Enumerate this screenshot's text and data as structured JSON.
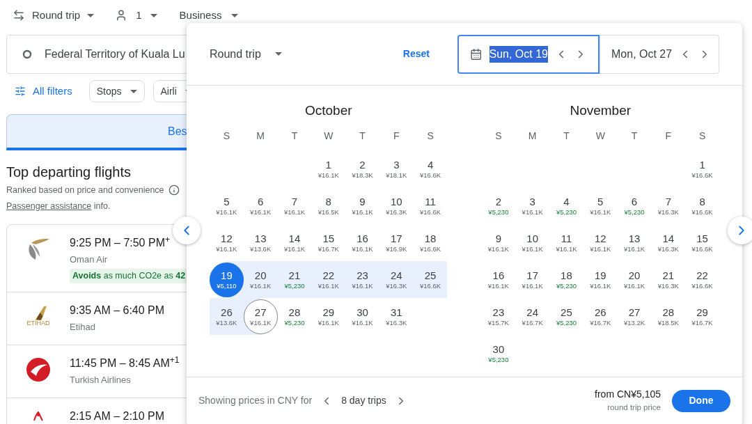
{
  "top_bar": {
    "trip_type": "Round trip",
    "passengers": "1",
    "cabin": "Business"
  },
  "search": {
    "origin": "Federal Territory of Kuala Lu"
  },
  "filters": {
    "all_filters": "All filters",
    "chips": [
      "Stops",
      "Airli"
    ]
  },
  "sort_tab": {
    "label": "Bes",
    "selected": true
  },
  "section": {
    "title": "Top departing flights",
    "subtitle": "Ranked based on price and convenience",
    "assistance_link": "Passenger assistance",
    "assistance_rest": " info."
  },
  "flights": [
    {
      "kind": "wing",
      "times": "9:25 PM – 7:50 PM$^{+}$",
      "airline": "Oman Air",
      "badge": "**Avoids** as much CO2e as **42**"
    },
    {
      "kind": "tail",
      "times": "9:35 AM – 6:40 PM",
      "airline": "Etihad",
      "logo_text": "ETIHAD"
    },
    {
      "kind": "crescent",
      "times": "11:45 PM – 8:45 AM$^{+1}$",
      "airline": "Turkish Airlines"
    },
    {
      "kind": "script",
      "times": "2:15 AM – 2:10 PM"
    }
  ],
  "date_picker": {
    "trip_type": "Round trip",
    "reset": "Reset",
    "depart": {
      "value": "Sun, Oct 19",
      "focused": true
    },
    "return": {
      "value": "Mon, Oct 27",
      "focused": false
    },
    "months": [
      {
        "name": "October",
        "weekdays": [
          "S",
          "M",
          "T",
          "W",
          "T",
          "F",
          "S"
        ],
        "weeks": [
          [
            {
              "kind": "blank"
            },
            {
              "kind": "blank"
            },
            {
              "kind": "blank"
            },
            {
              "day": "1",
              "price": "¥16.1K",
              "low": false,
              "kind": "plain"
            },
            {
              "day": "2",
              "price": "¥18.3K",
              "low": false,
              "kind": "plain"
            },
            {
              "day": "3",
              "price": "¥18.1K",
              "low": false,
              "kind": "plain"
            },
            {
              "day": "4",
              "price": "¥16.6K",
              "low": false,
              "kind": "plain"
            }
          ],
          [
            {
              "day": "5",
              "price": "¥16.1K",
              "low": false,
              "kind": "plain"
            },
            {
              "day": "6",
              "price": "¥16.1K",
              "low": false,
              "kind": "plain"
            },
            {
              "day": "7",
              "price": "¥16.1K",
              "low": false,
              "kind": "plain"
            },
            {
              "day": "8",
              "price": "¥16.5K",
              "low": false,
              "kind": "plain"
            },
            {
              "day": "9",
              "price": "¥16.1K",
              "low": false,
              "kind": "plain"
            },
            {
              "day": "10",
              "price": "¥16.3K",
              "low": false,
              "kind": "plain"
            },
            {
              "day": "11",
              "price": "¥16.6K",
              "low": false,
              "kind": "plain"
            }
          ],
          [
            {
              "day": "12",
              "price": "¥16.1K",
              "low": false,
              "kind": "plain"
            },
            {
              "day": "13",
              "price": "¥13.6K",
              "low": false,
              "kind": "plain"
            },
            {
              "day": "14",
              "price": "¥16.1K",
              "low": false,
              "kind": "plain"
            },
            {
              "day": "15",
              "price": "¥16.7K",
              "low": false,
              "kind": "plain"
            },
            {
              "day": "16",
              "price": "¥16.1K",
              "low": false,
              "kind": "plain"
            },
            {
              "day": "17",
              "price": "¥16.9K",
              "low": false,
              "kind": "plain"
            },
            {
              "day": "18",
              "price": "¥16.6K",
              "low": false,
              "kind": "plain"
            }
          ],
          [
            {
              "day": "19",
              "price": "¥5,110",
              "low": false,
              "kind": "start"
            },
            {
              "day": "20",
              "price": "¥16.1K",
              "low": false,
              "kind": "range"
            },
            {
              "day": "21",
              "price": "¥5,230",
              "low": true,
              "kind": "range"
            },
            {
              "day": "22",
              "price": "¥16.1K",
              "low": false,
              "kind": "range"
            },
            {
              "day": "23",
              "price": "¥16.1K",
              "low": false,
              "kind": "range"
            },
            {
              "day": "24",
              "price": "¥16.3K",
              "low": false,
              "kind": "range"
            },
            {
              "day": "25",
              "price": "¥16.6K",
              "low": false,
              "kind": "range"
            }
          ],
          [
            {
              "day": "26",
              "price": "¥13.6K",
              "low": false,
              "kind": "range"
            },
            {
              "day": "27",
              "price": "¥16.1K",
              "low": false,
              "kind": "end"
            },
            {
              "day": "28",
              "price": "¥5,230",
              "low": true,
              "kind": "plain"
            },
            {
              "day": "29",
              "price": "¥16.1K",
              "low": false,
              "kind": "plain"
            },
            {
              "day": "30",
              "price": "¥16.1K",
              "low": false,
              "kind": "plain"
            },
            {
              "day": "31",
              "price": "¥16.3K",
              "low": false,
              "kind": "plain"
            },
            {
              "kind": "blank"
            }
          ]
        ]
      },
      {
        "name": "November",
        "weekdays": [
          "S",
          "M",
          "T",
          "W",
          "T",
          "F",
          "S"
        ],
        "weeks": [
          [
            {
              "kind": "blank"
            },
            {
              "kind": "blank"
            },
            {
              "kind": "blank"
            },
            {
              "kind": "blank"
            },
            {
              "kind": "blank"
            },
            {
              "kind": "blank"
            },
            {
              "day": "1",
              "price": "¥16.6K",
              "low": false,
              "kind": "plain"
            }
          ],
          [
            {
              "day": "2",
              "price": "¥5,230",
              "low": true,
              "kind": "plain"
            },
            {
              "day": "3",
              "price": "¥16.1K",
              "low": false,
              "kind": "plain"
            },
            {
              "day": "4",
              "price": "¥5,230",
              "low": true,
              "kind": "plain"
            },
            {
              "day": "5",
              "price": "¥16.1K",
              "low": false,
              "kind": "plain"
            },
            {
              "day": "6",
              "price": "¥5,230",
              "low": true,
              "kind": "plain"
            },
            {
              "day": "7",
              "price": "¥16.3K",
              "low": false,
              "kind": "plain"
            },
            {
              "day": "8",
              "price": "¥16.6K",
              "low": false,
              "kind": "plain"
            }
          ],
          [
            {
              "day": "9",
              "price": "¥16.1K",
              "low": false,
              "kind": "plain"
            },
            {
              "day": "10",
              "price": "¥16.1K",
              "low": false,
              "kind": "plain"
            },
            {
              "day": "11",
              "price": "¥16.1K",
              "low": false,
              "kind": "plain"
            },
            {
              "day": "12",
              "price": "¥16.1K",
              "low": false,
              "kind": "plain"
            },
            {
              "day": "13",
              "price": "¥16.1K",
              "low": false,
              "kind": "plain"
            },
            {
              "day": "14",
              "price": "¥16.3K",
              "low": false,
              "kind": "plain"
            },
            {
              "day": "15",
              "price": "¥16.6K",
              "low": false,
              "kind": "plain"
            }
          ],
          [
            {
              "day": "16",
              "price": "¥16.1K",
              "low": false,
              "kind": "plain"
            },
            {
              "day": "17",
              "price": "¥16.1K",
              "low": false,
              "kind": "plain"
            },
            {
              "day": "18",
              "price": "¥5,230",
              "low": true,
              "kind": "plain"
            },
            {
              "day": "19",
              "price": "¥16.1K",
              "low": false,
              "kind": "plain"
            },
            {
              "day": "20",
              "price": "¥16.1K",
              "low": false,
              "kind": "plain"
            },
            {
              "day": "21",
              "price": "¥16.3K",
              "low": false,
              "kind": "plain"
            },
            {
              "day": "22",
              "price": "¥16.6K",
              "low": false,
              "kind": "plain"
            }
          ],
          [
            {
              "day": "23",
              "price": "¥15.7K",
              "low": false,
              "kind": "plain"
            },
            {
              "day": "24",
              "price": "¥16.7K",
              "low": false,
              "kind": "plain"
            },
            {
              "day": "25",
              "price": "¥5,230",
              "low": true,
              "kind": "plain"
            },
            {
              "day": "26",
              "price": "¥16.7K",
              "low": false,
              "kind": "plain"
            },
            {
              "day": "27",
              "price": "¥13.2K",
              "low": false,
              "kind": "plain"
            },
            {
              "day": "28",
              "price": "¥18.5K",
              "low": false,
              "kind": "plain"
            },
            {
              "day": "29",
              "price": "¥16.7K",
              "low": false,
              "kind": "plain"
            }
          ],
          [
            {
              "day": "30",
              "price": "¥5,230",
              "low": true,
              "kind": "plain"
            },
            {
              "kind": "blank"
            },
            {
              "kind": "blank"
            },
            {
              "kind": "blank"
            },
            {
              "kind": "blank"
            },
            {
              "kind": "blank"
            },
            {
              "kind": "blank"
            }
          ]
        ]
      }
    ],
    "footer": {
      "currency_note": "Showing prices in CNY for",
      "trip_length": "8 day trips",
      "from_price": "from CN¥5,105",
      "price_note": "round trip price",
      "done": "Done"
    }
  }
}
